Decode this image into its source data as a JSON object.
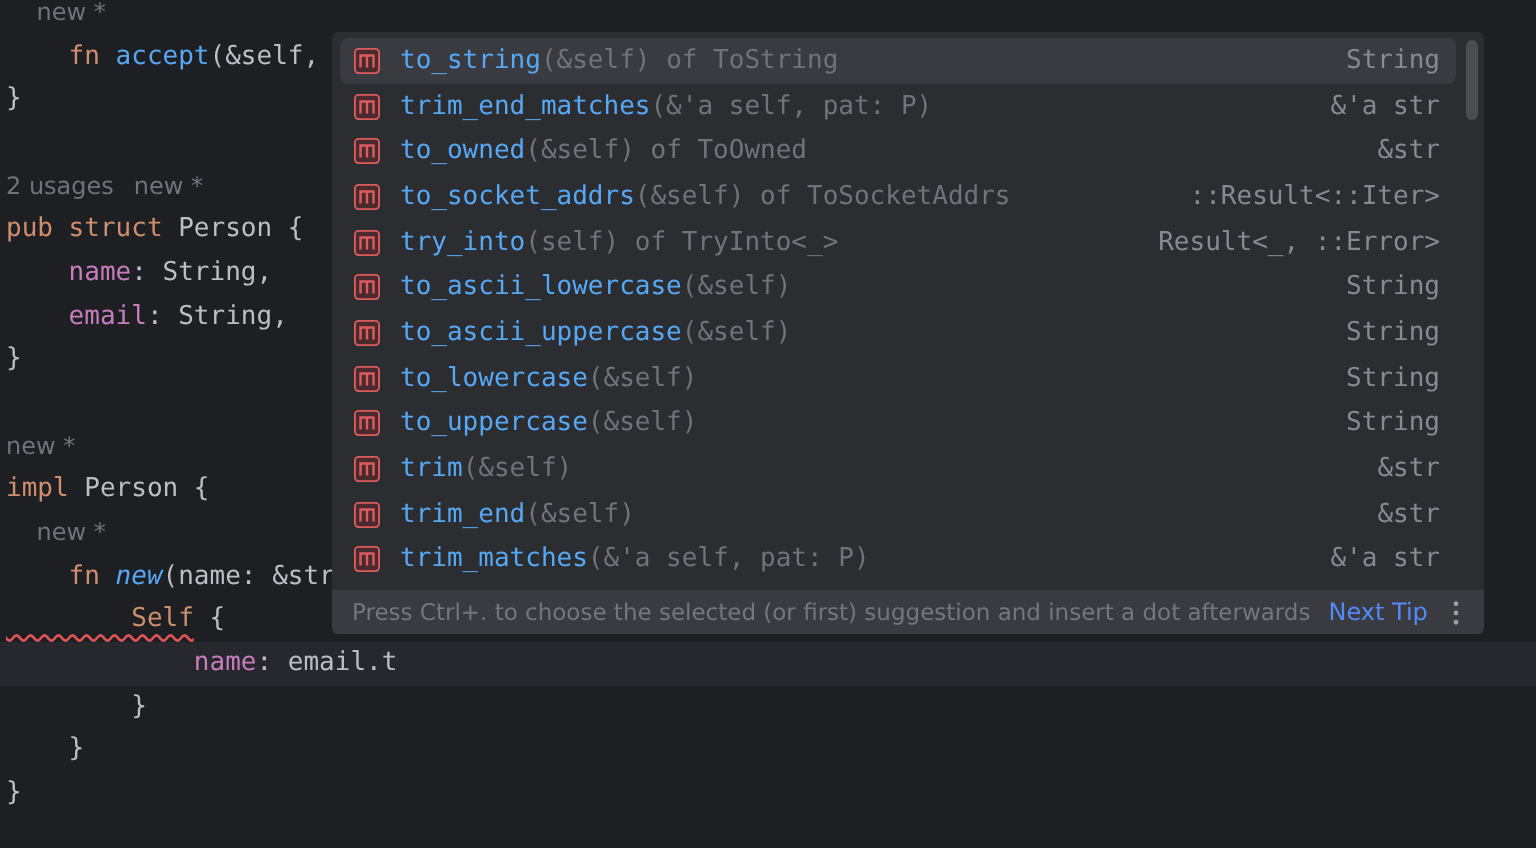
{
  "editor": {
    "lines": [
      {
        "current": false,
        "tokens": [
          {
            "text": "    new *",
            "kind": "hint"
          }
        ]
      },
      {
        "current": false,
        "tokens": [
          {
            "text": "    fn ",
            "kind": "keyword"
          },
          {
            "text": "accept",
            "kind": "function"
          },
          {
            "text": "(&self,",
            "kind": "plain"
          }
        ]
      },
      {
        "current": false,
        "tokens": [
          {
            "text": "}",
            "kind": "plain"
          }
        ]
      },
      {
        "current": false
      },
      {
        "current": false,
        "tokens": [
          {
            "text": "2 usages",
            "kind": "hint"
          },
          {
            "text": "new *",
            "kind": "hint"
          }
        ]
      },
      {
        "current": false,
        "tokens": [
          {
            "text": "pub struct ",
            "kind": "keyword"
          },
          {
            "text": "Person {",
            "kind": "plain"
          }
        ]
      },
      {
        "current": false,
        "tokens": [
          {
            "text": "    name",
            "kind": "field"
          },
          {
            "text": ": String,",
            "kind": "plain"
          }
        ]
      },
      {
        "current": false,
        "tokens": [
          {
            "text": "    email",
            "kind": "field"
          },
          {
            "text": ": String,",
            "kind": "plain"
          }
        ]
      },
      {
        "current": false,
        "tokens": [
          {
            "text": "}",
            "kind": "plain"
          }
        ]
      },
      {
        "current": false
      },
      {
        "current": false,
        "tokens": [
          {
            "text": "new *",
            "kind": "hint"
          }
        ]
      },
      {
        "current": false,
        "tokens": [
          {
            "text": "impl ",
            "kind": "keyword"
          },
          {
            "text": "Person {",
            "kind": "plain"
          }
        ]
      },
      {
        "current": false,
        "tokens": [
          {
            "text": "    new *",
            "kind": "hint"
          }
        ]
      },
      {
        "current": false,
        "tokens": [
          {
            "text": "    fn ",
            "kind": "keyword"
          },
          {
            "text": "new",
            "kind": "function_italic"
          },
          {
            "text": "(name: &str",
            "kind": "plain"
          }
        ]
      },
      {
        "current": false,
        "tokens": [
          {
            "text": "        Self",
            "kind": "keyword_error"
          },
          {
            "text": " {",
            "kind": "plain"
          }
        ]
      },
      {
        "current": true,
        "tokens": [
          {
            "text": "            name",
            "kind": "field"
          },
          {
            "text": ": email.t",
            "kind": "plain"
          }
        ]
      },
      {
        "current": false,
        "tokens": [
          {
            "text": "        }",
            "kind": "plain"
          }
        ]
      },
      {
        "current": false,
        "tokens": [
          {
            "text": "    }",
            "kind": "plain"
          }
        ]
      },
      {
        "current": false,
        "tokens": [
          {
            "text": "}",
            "kind": "plain"
          }
        ]
      }
    ]
  },
  "completion": {
    "items": [
      {
        "name": "to_string",
        "signature": "(&self) of ToString",
        "type": "String",
        "selected": true
      },
      {
        "name": "trim_end_matches",
        "signature": "(&'a self, pat: P)",
        "type": "&'a str",
        "selected": false
      },
      {
        "name": "to_owned",
        "signature": "(&self) of ToOwned",
        "type": "&str",
        "selected": false
      },
      {
        "name": "to_socket_addrs",
        "signature": "(&self) of ToSocketAddrs",
        "type": "::Result<::Iter>",
        "selected": false
      },
      {
        "name": "try_into",
        "signature": "(self) of TryInto<_>",
        "type": "Result<_, ::Error>",
        "selected": false
      },
      {
        "name": "to_ascii_lowercase",
        "signature": "(&self)",
        "type": "String",
        "selected": false
      },
      {
        "name": "to_ascii_uppercase",
        "signature": "(&self)",
        "type": "String",
        "selected": false
      },
      {
        "name": "to_lowercase",
        "signature": "(&self)",
        "type": "String",
        "selected": false
      },
      {
        "name": "to_uppercase",
        "signature": "(&self)",
        "type": "String",
        "selected": false
      },
      {
        "name": "trim",
        "signature": "(&self)",
        "type": "&str",
        "selected": false
      },
      {
        "name": "trim_end",
        "signature": "(&self)",
        "type": "&str",
        "selected": false
      },
      {
        "name": "trim_matches",
        "signature": "(&'a self, pat: P)",
        "type": "&'a str",
        "selected": false
      }
    ],
    "footer": {
      "hint": "Press Ctrl+. to choose the selected (or first) suggestion and insert a dot afterwards",
      "link": "Next Tip"
    }
  }
}
